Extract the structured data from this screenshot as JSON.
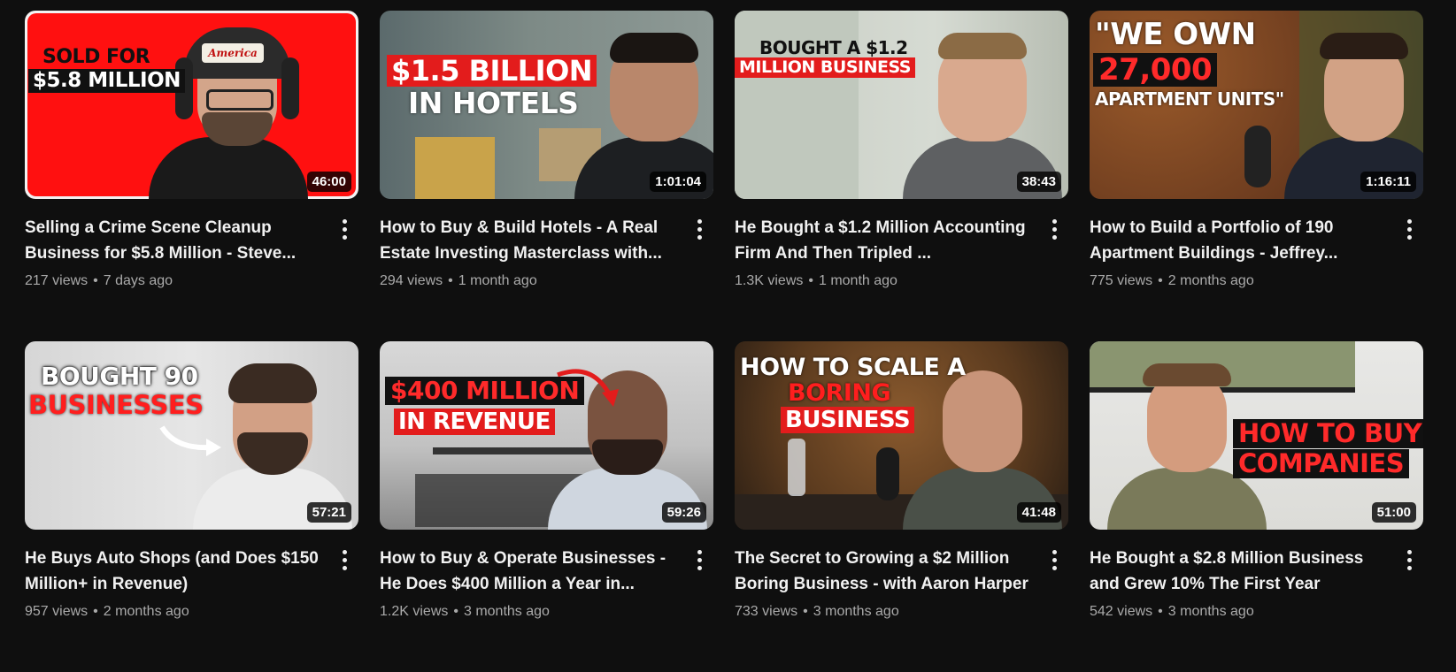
{
  "videos": [
    {
      "overlay": [
        "SOLD FOR",
        "$5.8 MILLION"
      ],
      "duration": "46:00",
      "title": "Selling a Crime Scene Cleanup Business for $5.8 Million - Steve...",
      "views": "217 views",
      "age": "7 days ago",
      "hat_text": "America"
    },
    {
      "overlay": [
        "$1.5 BILLION",
        "IN HOTELS"
      ],
      "duration": "1:01:04",
      "title": "How to Buy & Build Hotels - A Real Estate Investing Masterclass with...",
      "views": "294 views",
      "age": "1 month ago"
    },
    {
      "overlay": [
        "BOUGHT A $1.2",
        "MILLION BUSINESS"
      ],
      "duration": "38:43",
      "title": "He Bought a $1.2 Million Accounting Firm And Then Tripled ...",
      "views": "1.3K views",
      "age": "1 month ago"
    },
    {
      "overlay": [
        "\"WE OWN",
        "27,000",
        "APARTMENT UNITS\""
      ],
      "duration": "1:16:11",
      "title": "How to Build a Portfolio of 190 Apartment Buildings - Jeffrey...",
      "views": "775 views",
      "age": "2 months ago"
    },
    {
      "overlay": [
        "BOUGHT 90",
        "BUSINESSES"
      ],
      "duration": "57:21",
      "title": "He Buys Auto Shops (and Does $150 Million+ in Revenue)",
      "views": "957 views",
      "age": "2 months ago"
    },
    {
      "overlay": [
        "$400 MILLION",
        "IN REVENUE"
      ],
      "duration": "59:26",
      "title": "How to Buy & Operate Businesses - He Does $400 Million a Year in...",
      "views": "1.2K views",
      "age": "3 months ago"
    },
    {
      "overlay": [
        "HOW TO SCALE A",
        "BORING",
        "BUSINESS"
      ],
      "duration": "41:48",
      "title": "The Secret to Growing a $2 Million Boring Business - with Aaron Harper",
      "views": "733 views",
      "age": "3 months ago"
    },
    {
      "overlay": [
        "HOW TO BUY",
        "COMPANIES"
      ],
      "duration": "51:00",
      "title": "He Bought a $2.8 Million Business and Grew 10% The First Year",
      "views": "542 views",
      "age": "3 months ago"
    }
  ],
  "separator": "•"
}
